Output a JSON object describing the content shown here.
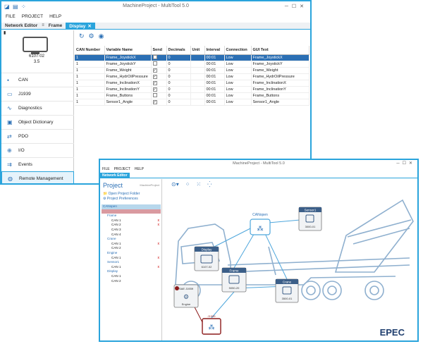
{
  "window1": {
    "title": "MachineProject - MultiTool 5.0",
    "menu": [
      "FILE",
      "PROJECT",
      "HELP"
    ],
    "tabs": {
      "network_editor": "Network Editor",
      "frame": "Frame",
      "display": "Display"
    },
    "device": {
      "name": "6107-02",
      "version": "3.5"
    },
    "nav": [
      {
        "label": "CAN",
        "icon": "can-network-icon"
      },
      {
        "label": "J1939",
        "icon": "j1939-icon"
      },
      {
        "label": "Diagnostics",
        "icon": "diagnostics-pulse-icon"
      },
      {
        "label": "Object Dictionary",
        "icon": "object-dictionary-icon"
      },
      {
        "label": "PDO",
        "icon": "pdo-icon"
      },
      {
        "label": "I/O",
        "icon": "io-icon"
      },
      {
        "label": "Events",
        "icon": "events-icon"
      },
      {
        "label": "Remote Management",
        "icon": "remote-management-globe-icon"
      }
    ],
    "table": {
      "headers": [
        "CAN Number",
        "Variable Name",
        "Send",
        "Decimals",
        "Unit",
        "Interval",
        "Connection",
        "GUI Text"
      ],
      "rows": [
        [
          "1",
          "Frame_JoystickX",
          "",
          "0",
          "",
          "00:01",
          "Low",
          "Frame_JoystickX"
        ],
        [
          "1",
          "Frame_JoystickY",
          "",
          "0",
          "",
          "00:01",
          "Low",
          "Frame_JoystickY"
        ],
        [
          "1",
          "Frame_Weight",
          "✓",
          "0",
          "",
          "00:01",
          "Low",
          "Frame_Weight"
        ],
        [
          "1",
          "Frame_HydrOilPressure",
          "✓",
          "0",
          "",
          "00:01",
          "Low",
          "Frame_HydrOilPressure"
        ],
        [
          "1",
          "Frame_InclinationX",
          "✓",
          "0",
          "",
          "00:01",
          "Low",
          "Frame_InclinationX"
        ],
        [
          "1",
          "Frame_InclinationY",
          "✓",
          "0",
          "",
          "00:01",
          "Low",
          "Frame_InclinationY"
        ],
        [
          "1",
          "Frame_Buttons",
          "",
          "0",
          "",
          "00:01",
          "Low",
          "Frame_Buttons"
        ],
        [
          "1",
          "Sensor1_Angle",
          "✓",
          "0",
          "",
          "00:01",
          "Low",
          "Sensor1_Angle"
        ]
      ]
    }
  },
  "window2": {
    "title": "MachineProject - MultiTool 5.0",
    "menu": [
      "FILE",
      "PROJECT",
      "HELP"
    ],
    "tab": "Network Editor",
    "project": {
      "title": "Project",
      "subtitle": "MachineProject",
      "open_folder": "Open Project Folder",
      "preferences": "Project Preferences"
    },
    "tree": [
      {
        "label": "CANopen",
        "cls": "root",
        "mark": ""
      },
      {
        "label": "",
        "cls": "hl",
        "mark": ""
      },
      {
        "label": "Frame",
        "cls": "cat lvl1",
        "mark": ""
      },
      {
        "label": "CAN 1",
        "cls": "lvl2",
        "mark": "x"
      },
      {
        "label": "CAN 2",
        "cls": "lvl2",
        "mark": "x"
      },
      {
        "label": "CAN 3",
        "cls": "lvl2",
        "mark": ""
      },
      {
        "label": "CAN 4",
        "cls": "lvl2",
        "mark": ""
      },
      {
        "label": "Crane",
        "cls": "cat lvl1",
        "mark": ""
      },
      {
        "label": "CAN 1",
        "cls": "lvl2",
        "mark": "x"
      },
      {
        "label": "CAN 2",
        "cls": "lvl2",
        "mark": ""
      },
      {
        "label": "Engine",
        "cls": "cat lvl1",
        "mark": ""
      },
      {
        "label": "CAN 1",
        "cls": "lvl2",
        "mark": "x"
      },
      {
        "label": "Sensor1",
        "cls": "cat lvl1",
        "mark": ""
      },
      {
        "label": "CAN 1",
        "cls": "lvl2",
        "mark": "x"
      },
      {
        "label": "Display",
        "cls": "cat lvl1",
        "mark": ""
      },
      {
        "label": "CAN 1",
        "cls": "lvl2",
        "mark": ""
      },
      {
        "label": "CAN 2",
        "cls": "lvl2",
        "mark": ""
      }
    ],
    "nodes": {
      "canopen": "CANopen",
      "sensor1": {
        "title": "Sensor1",
        "model": "3000-01"
      },
      "display": {
        "title": "Display",
        "model": "6107-02"
      },
      "frame": {
        "title": "Frame",
        "model": "5050-20"
      },
      "crane": {
        "title": "Crane",
        "model": "3500-01"
      },
      "engine": {
        "title": "SAE J1939",
        "label": "Engine"
      },
      "j1939": "J1939"
    },
    "logo": "EPEC"
  },
  "colors": {
    "accent": "#2aa4dc",
    "selection": "#2b6fb4",
    "highlight": "#d99aa0",
    "error": "#c00000"
  }
}
